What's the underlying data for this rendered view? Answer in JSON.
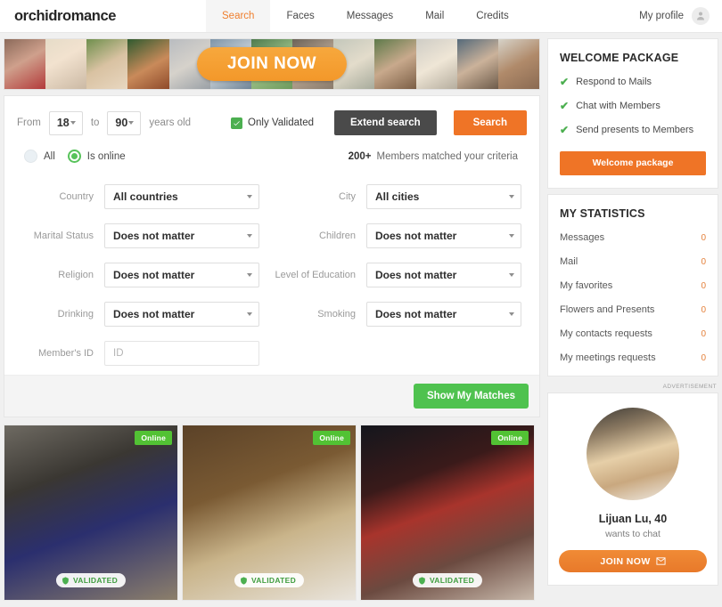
{
  "header": {
    "logo": "orchidromance",
    "nav": [
      {
        "label": "Search",
        "active": true
      },
      {
        "label": "Faces",
        "active": false
      },
      {
        "label": "Messages",
        "active": false
      },
      {
        "label": "Mail",
        "active": false
      },
      {
        "label": "Credits",
        "active": false
      }
    ],
    "my_profile": "My profile",
    "avatar_icon": "user-avatar-icon"
  },
  "banner": {
    "cta": "JOIN NOW"
  },
  "search": {
    "from_label": "From",
    "from_value": "18",
    "to_label": "to",
    "to_value": "90",
    "years_old_label": "years old",
    "only_validated_label": "Only Validated",
    "only_validated_checked": true,
    "extend_search": "Extend search",
    "search_button": "Search",
    "radio_all": "All",
    "radio_online": "Is online",
    "radio_selected": "Is online",
    "match_count": "200+",
    "match_text": "Members matched your criteria",
    "show_matches": "Show My Matches",
    "fields": [
      {
        "label": "Country",
        "value": "All countries",
        "type": "select"
      },
      {
        "label": "City",
        "value": "All cities",
        "type": "select"
      },
      {
        "label": "Marital Status",
        "value": "Does not matter",
        "type": "select"
      },
      {
        "label": "Children",
        "value": "Does not matter",
        "type": "select"
      },
      {
        "label": "Religion",
        "value": "Does not matter",
        "type": "select"
      },
      {
        "label": "Level of Education",
        "value": "Does not matter",
        "type": "select"
      },
      {
        "label": "Drinking",
        "value": "Does not matter",
        "type": "select"
      },
      {
        "label": "Smoking",
        "value": "Does not matter",
        "type": "select"
      },
      {
        "label": "Member's ID",
        "value": "",
        "placeholder": "ID",
        "type": "input"
      }
    ]
  },
  "cards": [
    {
      "online_badge": "Online",
      "validated_badge": "VALIDATED"
    },
    {
      "online_badge": "Online",
      "validated_badge": "VALIDATED"
    },
    {
      "online_badge": "Online",
      "validated_badge": "VALIDATED"
    }
  ],
  "welcome_package": {
    "title": "WELCOME PACKAGE",
    "perks": [
      "Respond to Mails",
      "Chat with Members",
      "Send presents to Members"
    ],
    "check_glyph": "✔",
    "button": "Welcome package"
  },
  "statistics": {
    "title": "MY STATISTICS",
    "rows": [
      {
        "name": "Messages",
        "value": "0"
      },
      {
        "name": "Mail",
        "value": "0"
      },
      {
        "name": "My favorites",
        "value": "0"
      },
      {
        "name": "Flowers and Presents",
        "value": "0"
      },
      {
        "name": "My contacts requests",
        "value": "0"
      },
      {
        "name": "My meetings requests",
        "value": "0"
      }
    ]
  },
  "advertisement": {
    "label": "ADVERTISEMENT",
    "name": "Lijuan Lu, 40",
    "subtitle": "wants to chat",
    "button": "JOIN NOW",
    "button_icon": "envelope-icon"
  },
  "colors": {
    "accent_orange": "#ef7426",
    "green": "#4fc24f",
    "dark_button": "#4a4a4a",
    "banner_orange": "#f3982a"
  }
}
